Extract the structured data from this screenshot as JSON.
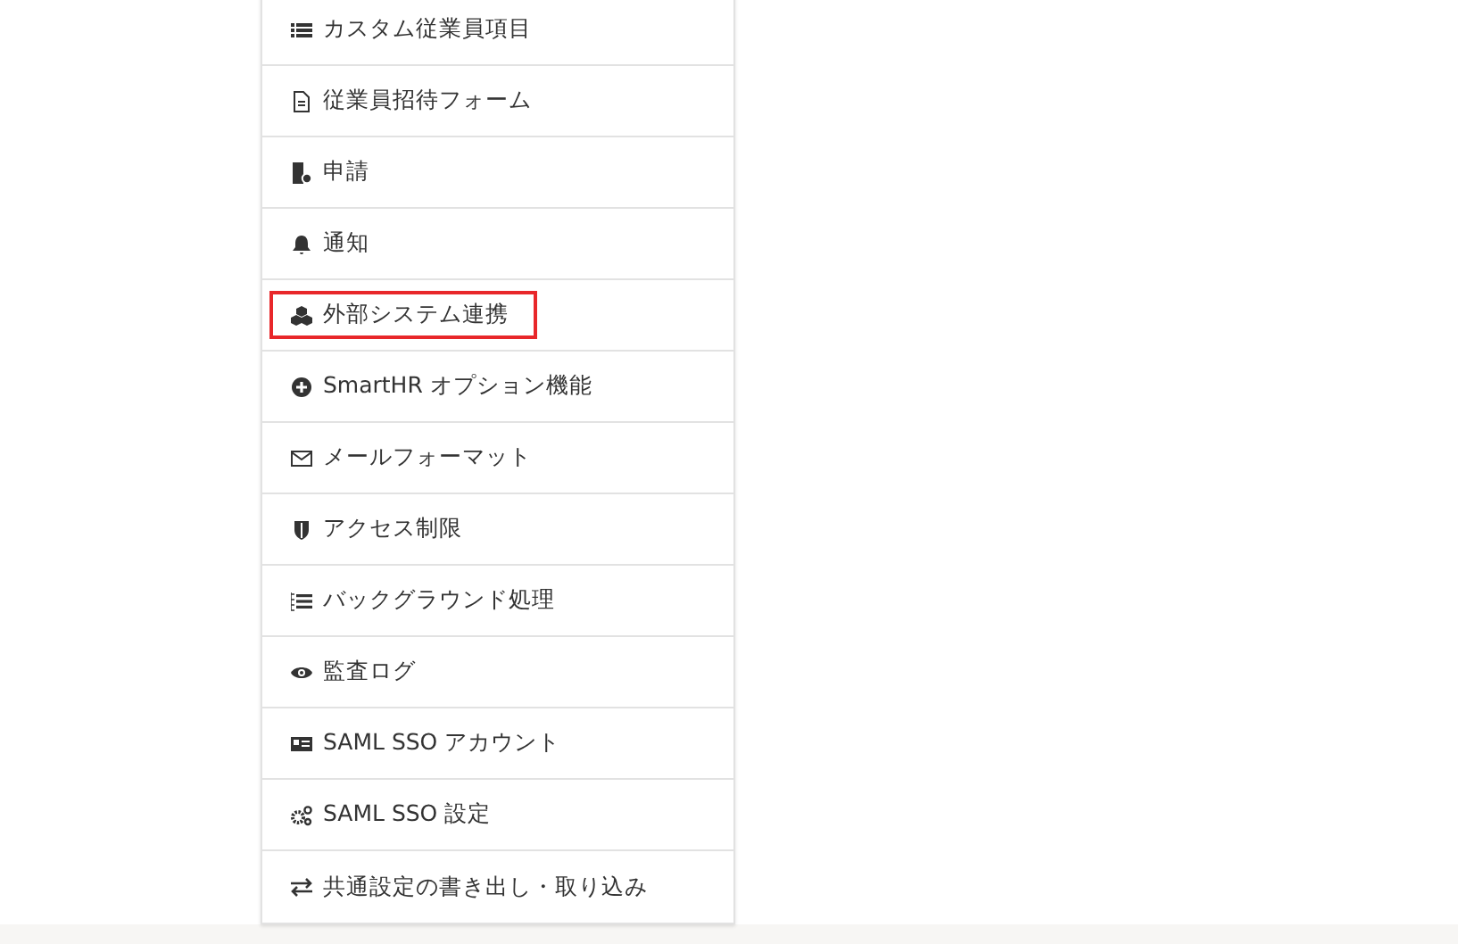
{
  "menu": {
    "items": [
      {
        "label": "カスタム従業員項目",
        "kind": "list",
        "highlighted": false
      },
      {
        "label": "従業員招待フォーム",
        "kind": "document",
        "highlighted": false
      },
      {
        "label": "申請",
        "kind": "request",
        "highlighted": false
      },
      {
        "label": "通知",
        "kind": "bell",
        "highlighted": false
      },
      {
        "label": "外部システム連携",
        "kind": "cubes",
        "highlighted": true
      },
      {
        "label": "SmartHR オプション機能",
        "kind": "plus",
        "highlighted": false
      },
      {
        "label": "メールフォーマット",
        "kind": "envelope",
        "highlighted": false
      },
      {
        "label": "アクセス制限",
        "kind": "shield",
        "highlighted": false
      },
      {
        "label": "バックグラウンド処理",
        "kind": "tasks",
        "highlighted": false
      },
      {
        "label": "監査ログ",
        "kind": "eye",
        "highlighted": false
      },
      {
        "label": "SAML SSO アカウント",
        "kind": "card",
        "highlighted": false
      },
      {
        "label": "SAML SSO 設定",
        "kind": "gears",
        "highlighted": false
      },
      {
        "label": "共通設定の書き出し・取り込み",
        "kind": "exchange",
        "highlighted": false
      }
    ]
  }
}
